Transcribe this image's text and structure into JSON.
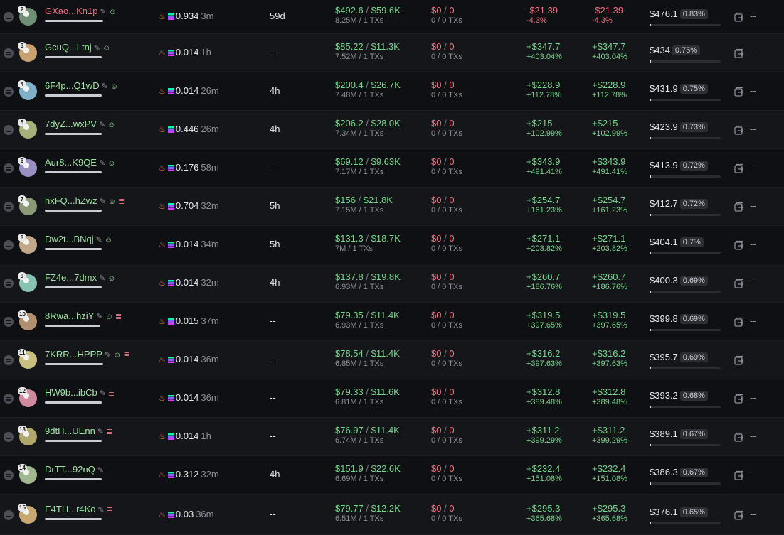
{
  "colors": {
    "background": "#0f1013",
    "green": "#74d68b",
    "red": "#f06e7f",
    "name_green": "#9fe3a2"
  },
  "icons": {
    "row_menu": "list-menu-icon",
    "edit": "pencil-icon",
    "follow": "user-add-icon",
    "layers": "layers-icon",
    "share": "share-icon",
    "fire": "fire-icon",
    "token": "solana-icon"
  },
  "rows": [
    {
      "rank": "2",
      "name": "GXao...Kn1p",
      "name_color": "pink",
      "layers": false,
      "follow": true,
      "bal": "0.934",
      "bal_time": "3m",
      "hold": "59d",
      "buy_usd": "$492.6",
      "buy_mc": "$59.6K",
      "buy_sub": "8.25M / 1 TXs",
      "sell_usd": "$0",
      "sell_mc": "0",
      "sell_sub": "0 / 0 TXs",
      "pnl1": "-$21.39",
      "pnl1_pct": "-4.3%",
      "pnl2": "-$21.39",
      "pnl2_pct": "-4.3%",
      "pnl_neg": true,
      "rem": "$476.1",
      "rem_pct": "0.83%",
      "dash": "--",
      "bar": 0.6
    },
    {
      "rank": "3",
      "name": "GcuQ...Ltnj",
      "name_color": "green",
      "layers": false,
      "follow": true,
      "bal": "0.014",
      "bal_time": "1h",
      "hold": "--",
      "buy_usd": "$85.22",
      "buy_mc": "$11.3K",
      "buy_sub": "7.52M / 1 TXs",
      "sell_usd": "$0",
      "sell_mc": "0",
      "sell_sub": "0 / 0 TXs",
      "pnl1": "+$347.7",
      "pnl1_pct": "+403.04%",
      "pnl2": "+$347.7",
      "pnl2_pct": "+403.04%",
      "pnl_neg": false,
      "rem": "$434",
      "rem_pct": "0.75%",
      "dash": "--",
      "bar": 0.6
    },
    {
      "rank": "4",
      "name": "6F4p...Q1wD",
      "name_color": "green",
      "layers": false,
      "follow": true,
      "bal": "0.014",
      "bal_time": "26m",
      "hold": "4h",
      "buy_usd": "$200.4",
      "buy_mc": "$26.7K",
      "buy_sub": "7.48M / 1 TXs",
      "sell_usd": "$0",
      "sell_mc": "0",
      "sell_sub": "0 / 0 TXs",
      "pnl1": "+$228.9",
      "pnl1_pct": "+112.78%",
      "pnl2": "+$228.9",
      "pnl2_pct": "+112.78%",
      "pnl_neg": false,
      "rem": "$431.9",
      "rem_pct": "0.75%",
      "dash": "--",
      "bar": 0.6
    },
    {
      "rank": "5",
      "name": "7dyZ...wxPV",
      "name_color": "green",
      "layers": false,
      "follow": true,
      "bal": "0.446",
      "bal_time": "26m",
      "hold": "4h",
      "buy_usd": "$206.2",
      "buy_mc": "$28.0K",
      "buy_sub": "7.34M / 1 TXs",
      "sell_usd": "$0",
      "sell_mc": "0",
      "sell_sub": "0 / 0 TXs",
      "pnl1": "+$215",
      "pnl1_pct": "+102.99%",
      "pnl2": "+$215",
      "pnl2_pct": "+102.99%",
      "pnl_neg": false,
      "rem": "$423.9",
      "rem_pct": "0.73%",
      "dash": "--",
      "bar": 0.6
    },
    {
      "rank": "6",
      "name": "Aur8...K9QE",
      "name_color": "green",
      "layers": false,
      "follow": true,
      "bal": "0.176",
      "bal_time": "58m",
      "hold": "--",
      "buy_usd": "$69.12",
      "buy_mc": "$9.63K",
      "buy_sub": "7.17M / 1 TXs",
      "sell_usd": "$0",
      "sell_mc": "0",
      "sell_sub": "0 / 0 TXs",
      "pnl1": "+$343.9",
      "pnl1_pct": "+491.41%",
      "pnl2": "+$343.9",
      "pnl2_pct": "+491.41%",
      "pnl_neg": false,
      "rem": "$413.9",
      "rem_pct": "0.72%",
      "dash": "--",
      "bar": 0.6
    },
    {
      "rank": "7",
      "name": "hxFQ...hZwz",
      "name_color": "green",
      "layers": true,
      "follow": true,
      "bal": "0.704",
      "bal_time": "32m",
      "hold": "5h",
      "buy_usd": "$156",
      "buy_mc": "$21.8K",
      "buy_sub": "7.15M / 1 TXs",
      "sell_usd": "$0",
      "sell_mc": "0",
      "sell_sub": "0 / 0 TXs",
      "pnl1": "+$254.7",
      "pnl1_pct": "+161.23%",
      "pnl2": "+$254.7",
      "pnl2_pct": "+161.23%",
      "pnl_neg": false,
      "rem": "$412.7",
      "rem_pct": "0.72%",
      "dash": "--",
      "bar": 0.6
    },
    {
      "rank": "8",
      "name": "Dw2t...BNqj",
      "name_color": "green",
      "layers": false,
      "follow": true,
      "bal": "0.014",
      "bal_time": "34m",
      "hold": "5h",
      "buy_usd": "$131.3",
      "buy_mc": "$18.7K",
      "buy_sub": "7M / 1 TXs",
      "sell_usd": "$0",
      "sell_mc": "0",
      "sell_sub": "0 / 0 TXs",
      "pnl1": "+$271.1",
      "pnl1_pct": "+203.82%",
      "pnl2": "+$271.1",
      "pnl2_pct": "+203.82%",
      "pnl_neg": false,
      "rem": "$404.1",
      "rem_pct": "0.7%",
      "dash": "--",
      "bar": 0.6
    },
    {
      "rank": "9",
      "name": "FZ4e...7dmx",
      "name_color": "green",
      "layers": false,
      "follow": true,
      "bal": "0.014",
      "bal_time": "32m",
      "hold": "4h",
      "buy_usd": "$137.8",
      "buy_mc": "$19.8K",
      "buy_sub": "6.93M / 1 TXs",
      "sell_usd": "$0",
      "sell_mc": "0",
      "sell_sub": "0 / 0 TXs",
      "pnl1": "+$260.7",
      "pnl1_pct": "+186.76%",
      "pnl2": "+$260.7",
      "pnl2_pct": "+186.76%",
      "pnl_neg": false,
      "rem": "$400.3",
      "rem_pct": "0.69%",
      "dash": "--",
      "bar": 0.6
    },
    {
      "rank": "10",
      "name": "8Rwa...hziY",
      "name_color": "green",
      "layers": true,
      "follow": true,
      "bal": "0.015",
      "bal_time": "37m",
      "hold": "--",
      "buy_usd": "$79.35",
      "buy_mc": "$11.4K",
      "buy_sub": "6.93M / 1 TXs",
      "sell_usd": "$0",
      "sell_mc": "0",
      "sell_sub": "0 / 0 TXs",
      "pnl1": "+$319.5",
      "pnl1_pct": "+397.65%",
      "pnl2": "+$319.5",
      "pnl2_pct": "+397.65%",
      "pnl_neg": false,
      "rem": "$399.8",
      "rem_pct": "0.69%",
      "dash": "--",
      "bar": 0.6
    },
    {
      "rank": "11",
      "name": "7KRR...HPPP",
      "name_color": "green",
      "layers": true,
      "follow": true,
      "bal": "0.014",
      "bal_time": "36m",
      "hold": "--",
      "buy_usd": "$78.54",
      "buy_mc": "$11.4K",
      "buy_sub": "6.85M / 1 TXs",
      "sell_usd": "$0",
      "sell_mc": "0",
      "sell_sub": "0 / 0 TXs",
      "pnl1": "+$316.2",
      "pnl1_pct": "+397.63%",
      "pnl2": "+$316.2",
      "pnl2_pct": "+397.63%",
      "pnl_neg": false,
      "rem": "$395.7",
      "rem_pct": "0.69%",
      "dash": "--",
      "bar": 0.6
    },
    {
      "rank": "12",
      "name": "HW9b...ibCb",
      "name_color": "green",
      "layers": true,
      "follow": false,
      "bal": "0.014",
      "bal_time": "36m",
      "hold": "--",
      "buy_usd": "$79.33",
      "buy_mc": "$11.6K",
      "buy_sub": "6.81M / 1 TXs",
      "sell_usd": "$0",
      "sell_mc": "0",
      "sell_sub": "0 / 0 TXs",
      "pnl1": "+$312.8",
      "pnl1_pct": "+389.48%",
      "pnl2": "+$312.8",
      "pnl2_pct": "+389.48%",
      "pnl_neg": false,
      "rem": "$393.2",
      "rem_pct": "0.68%",
      "dash": "--",
      "bar": 0.6
    },
    {
      "rank": "13",
      "name": "9dtH...UEnn",
      "name_color": "green",
      "layers": true,
      "follow": false,
      "bal": "0.014",
      "bal_time": "1h",
      "hold": "--",
      "buy_usd": "$76.97",
      "buy_mc": "$11.4K",
      "buy_sub": "6.74M / 1 TXs",
      "sell_usd": "$0",
      "sell_mc": "0",
      "sell_sub": "0 / 0 TXs",
      "pnl1": "+$311.2",
      "pnl1_pct": "+399.29%",
      "pnl2": "+$311.2",
      "pnl2_pct": "+399.29%",
      "pnl_neg": false,
      "rem": "$389.1",
      "rem_pct": "0.67%",
      "dash": "--",
      "bar": 0.6
    },
    {
      "rank": "14",
      "name": "DrTT...92nQ",
      "name_color": "green",
      "layers": false,
      "follow": false,
      "bal": "0.312",
      "bal_time": "32m",
      "hold": "4h",
      "buy_usd": "$151.9",
      "buy_mc": "$22.6K",
      "buy_sub": "6.69M / 1 TXs",
      "sell_usd": "$0",
      "sell_mc": "0",
      "sell_sub": "0 / 0 TXs",
      "pnl1": "+$232.4",
      "pnl1_pct": "+151.08%",
      "pnl2": "+$232.4",
      "pnl2_pct": "+151.08%",
      "pnl_neg": false,
      "rem": "$386.3",
      "rem_pct": "0.67%",
      "dash": "--",
      "bar": 0.6
    },
    {
      "rank": "15",
      "name": "E4TH...r4Ko",
      "name_color": "green",
      "layers": true,
      "follow": false,
      "bal": "0.03",
      "bal_time": "36m",
      "hold": "--",
      "buy_usd": "$79.77",
      "buy_mc": "$12.2K",
      "buy_sub": "6.51M / 1 TXs",
      "sell_usd": "$0",
      "sell_mc": "0",
      "sell_sub": "0 / 0 TXs",
      "pnl1": "+$295.3",
      "pnl1_pct": "+365.68%",
      "pnl2": "+$295.3",
      "pnl2_pct": "+365.68%",
      "pnl_neg": false,
      "rem": "$376.1",
      "rem_pct": "0.65%",
      "dash": "--",
      "bar": 0.6
    }
  ]
}
